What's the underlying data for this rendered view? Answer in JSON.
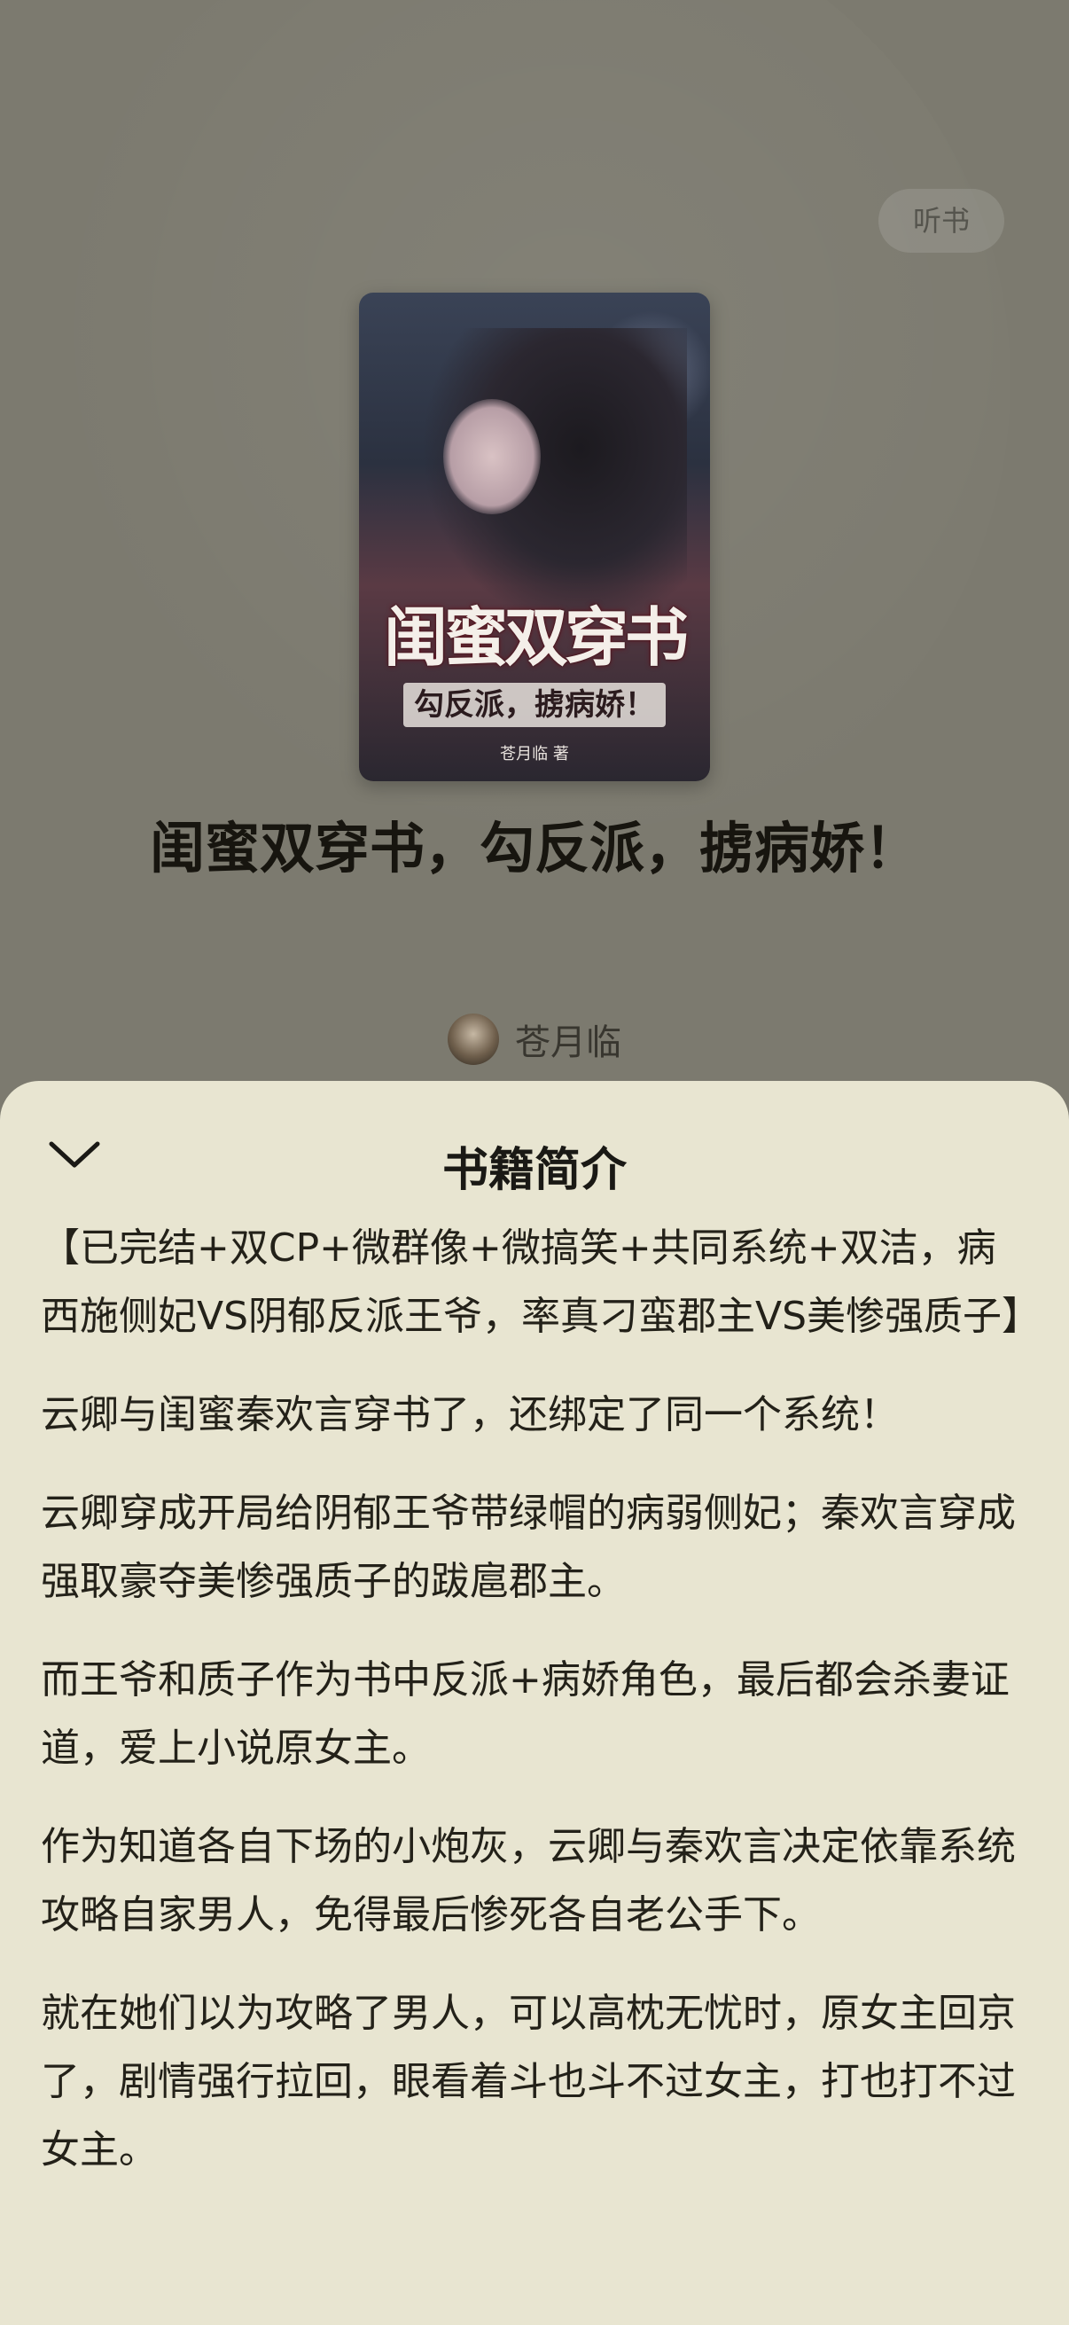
{
  "top": {
    "listen_label": "听书"
  },
  "cover": {
    "title": "闺蜜双穿书",
    "subtitle": "勾反派，掳病娇！",
    "author_text": "苍月临 著"
  },
  "book": {
    "title": "闺蜜双穿书，勾反派，掳病娇！",
    "author": "苍月临"
  },
  "sheet": {
    "title": "书籍简介",
    "paragraphs": [
      "【已完结+双CP+微群像+微搞笑+共同系统+双洁，病西施侧妃VS阴郁反派王爷，率真刁蛮郡主VS美惨强质子】",
      "云卿与闺蜜秦欢言穿书了，还绑定了同一个系统！",
      "云卿穿成开局给阴郁王爷带绿帽的病弱侧妃；秦欢言穿成强取豪夺美惨强质子的跋扈郡主。",
      "而王爷和质子作为书中反派+病娇角色，最后都会杀妻证道，爱上小说原女主。",
      "作为知道各自下场的小炮灰，云卿与秦欢言决定依靠系统攻略自家男人，免得最后惨死各自老公手下。",
      "就在她们以为攻略了男人，可以高枕无忧时，原女主回京了，剧情强行拉回，眼看着斗也斗不过女主，打也打不过女主。"
    ]
  },
  "icons": {
    "collapse": "chevron-down-icon",
    "avatar": "author-avatar"
  }
}
